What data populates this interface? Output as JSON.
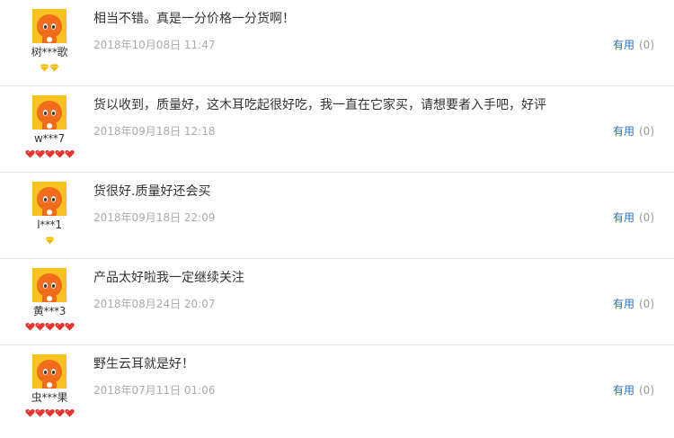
{
  "reviews": [
    {
      "username": "树***歌",
      "comment": "相当不错。真是一分价格一分货啊！",
      "date": "2018年10月08日 11:47",
      "useful_label": "有用",
      "useful_count": "(0)",
      "badge_type": "gold-diamond",
      "badge_count": 2
    },
    {
      "username": "w***7",
      "comment": "货以收到，质量好，这木耳吃起很好吃，我一直在它家买，请想要者入手吧，好评",
      "date": "2018年09月18日 12:18",
      "useful_label": "有用",
      "useful_count": "(0)",
      "badge_type": "red-heart",
      "badge_count": 5
    },
    {
      "username": "l***1",
      "comment": "货很好.质量好还会买",
      "date": "2018年09月18日 22:09",
      "useful_label": "有用",
      "useful_count": "(0)",
      "badge_type": "gold-diamond",
      "badge_count": 1
    },
    {
      "username": "黄***3",
      "comment": "产品太好啦我一定继续关注",
      "date": "2018年08月24日 20:07",
      "useful_label": "有用",
      "useful_count": "(0)",
      "badge_type": "red-heart",
      "badge_count": 5
    },
    {
      "username": "虫***果",
      "comment": "野生云耳就是好！",
      "date": "2018年07月11日 01:06",
      "useful_label": "有用",
      "useful_count": "(0)",
      "badge_type": "red-heart",
      "badge_count": 5
    }
  ],
  "colors": {
    "link_blue": "#2b6fc2",
    "date_gray": "#aaaaaa",
    "avatar_bg": "#f7c21f",
    "avatar_mascot": "#f36b1c",
    "heart_red": "#e8322d",
    "diamond_gold": "#f5b800"
  }
}
